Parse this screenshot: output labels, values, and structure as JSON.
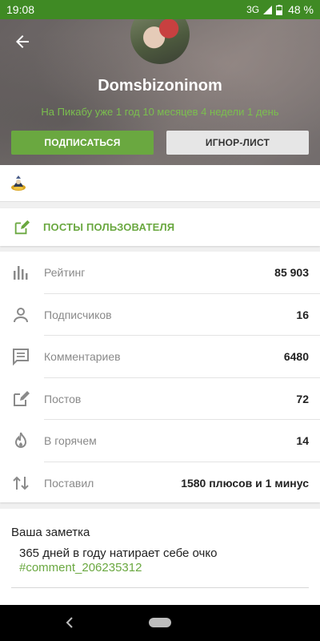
{
  "status_bar": {
    "time": "19:08",
    "network": "3G",
    "battery": "48 %"
  },
  "profile": {
    "username": "Domsbizoninom",
    "since": "На Пикабу уже 1 год 10 месяцев 4 недели 1 день",
    "subscribe_label": "ПОДПИСАТЬСЯ",
    "ignore_label": "ИГНОР-ЛИСТ"
  },
  "posts_link": {
    "label": "ПОСТЫ ПОЛЬЗОВАТЕЛЯ"
  },
  "stats": [
    {
      "icon": "rating-icon",
      "label": "Рейтинг",
      "value": "85 903"
    },
    {
      "icon": "person-icon",
      "label": "Подписчиков",
      "value": "16"
    },
    {
      "icon": "comment-icon",
      "label": "Комментариев",
      "value": "6480"
    },
    {
      "icon": "edit-icon",
      "label": "Постов",
      "value": "72"
    },
    {
      "icon": "flame-icon",
      "label": "В горячем",
      "value": "14"
    },
    {
      "icon": "sort-arrows-icon",
      "label": "Поставил",
      "value": "1580 плюсов и 1 минус"
    }
  ],
  "note": {
    "title": "Ваша заметка",
    "text": "365 дней в году натирает себе очко",
    "link": "#comment_206235312"
  },
  "colors": {
    "status_bar": "#3f8a24",
    "accent_green": "#6aa840",
    "since_text": "#7bbf4e"
  }
}
